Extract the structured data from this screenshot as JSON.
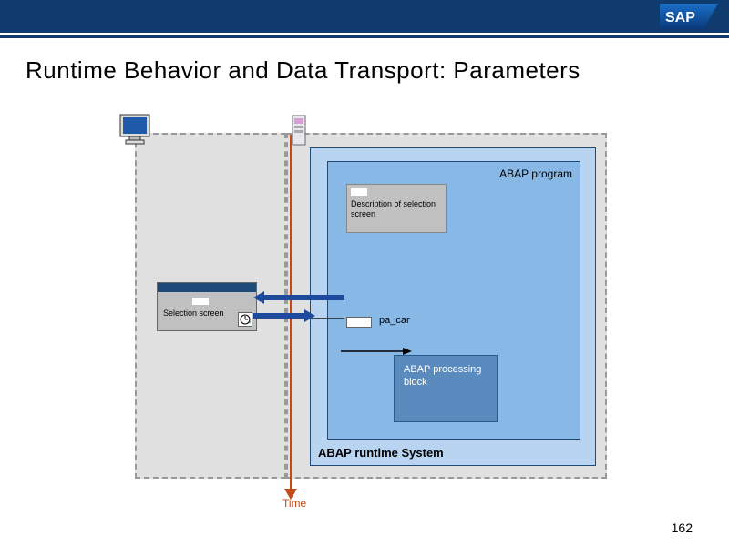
{
  "logo": "SAP",
  "title": "Runtime Behavior and Data Transport: Parameters",
  "runtime_label": "ABAP runtime System",
  "program_label": "ABAP program",
  "desc_box": "Description of selection screen",
  "pa_var": "pa_car",
  "proc_block": "ABAP processing block",
  "sel_screen": "Selection screen",
  "time_label": "Time",
  "page_number": "162"
}
